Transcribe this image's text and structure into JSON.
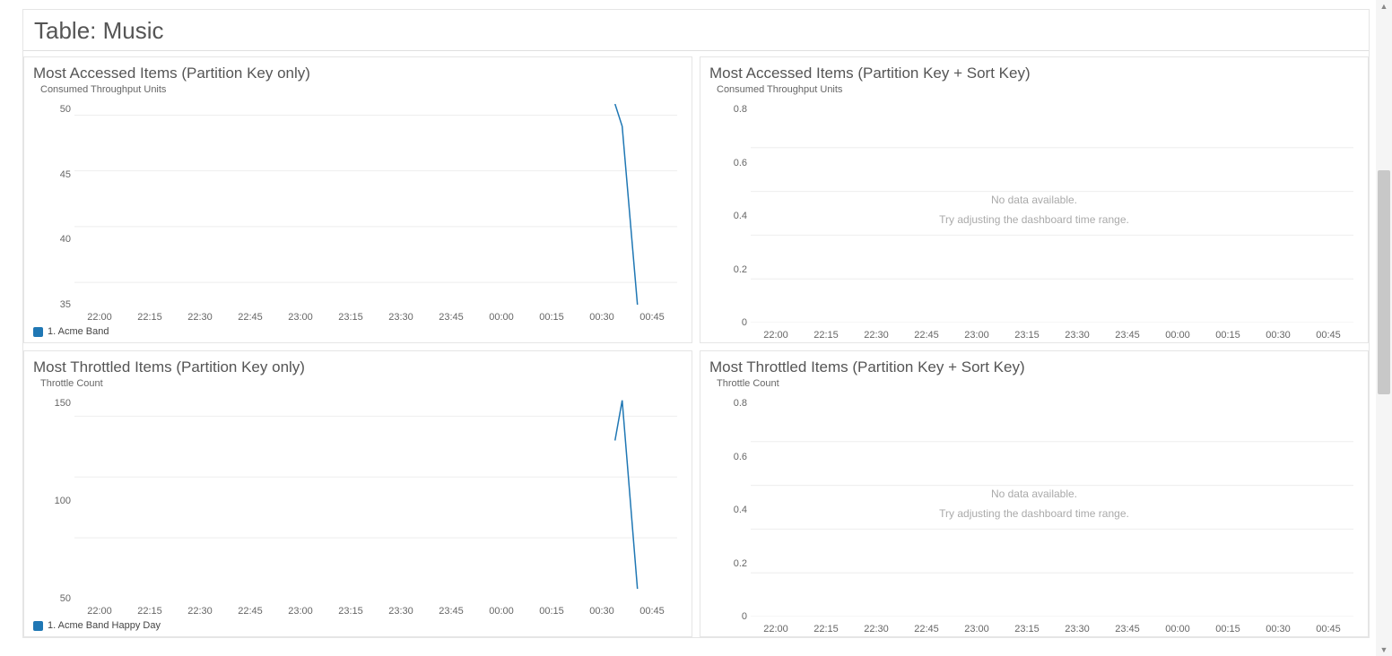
{
  "section": {
    "title": "Table: Music"
  },
  "time_labels": [
    "22:00",
    "22:15",
    "22:30",
    "22:45",
    "23:00",
    "23:15",
    "23:30",
    "23:45",
    "00:00",
    "00:15",
    "00:30",
    "00:45"
  ],
  "nodata": {
    "line1": "No data available.",
    "line2": "Try adjusting the dashboard time range."
  },
  "panels": {
    "p0": {
      "title": "Most Accessed Items (Partition Key only)",
      "yaxis_title": "Consumed Throughput Units",
      "legend": "1. Acme Band"
    },
    "p1": {
      "title": "Most Accessed Items (Partition Key + Sort Key)",
      "yaxis_title": "Consumed Throughput Units"
    },
    "p2": {
      "title": "Most Throttled Items (Partition Key only)",
      "yaxis_title": "Throttle Count",
      "legend": "1. Acme Band Happy Day"
    },
    "p3": {
      "title": "Most Throttled Items (Partition Key + Sort Key)",
      "yaxis_title": "Throttle Count"
    }
  },
  "chart_data": [
    {
      "id": "p0",
      "type": "line",
      "title": "Most Accessed Items (Partition Key only)",
      "ylabel": "Consumed Throughput Units",
      "xlabel": "",
      "x": [
        "22:00",
        "22:15",
        "22:30",
        "22:45",
        "23:00",
        "23:15",
        "23:30",
        "23:45",
        "00:00",
        "00:15",
        "00:30",
        "00:45"
      ],
      "yticks": [
        35,
        40,
        45,
        50
      ],
      "ylim": [
        33,
        51
      ],
      "series": [
        {
          "name": "1. Acme Band",
          "points": [
            {
              "x": "00:45",
              "y": 51
            },
            {
              "x": "00:47",
              "y": 49
            },
            {
              "x": "00:52",
              "y": 33
            }
          ]
        }
      ]
    },
    {
      "id": "p1",
      "type": "line",
      "title": "Most Accessed Items (Partition Key + Sort Key)",
      "ylabel": "Consumed Throughput Units",
      "xlabel": "",
      "x": [
        "22:00",
        "22:15",
        "22:30",
        "22:45",
        "23:00",
        "23:15",
        "23:30",
        "23:45",
        "00:00",
        "00:15",
        "00:30",
        "00:45"
      ],
      "yticks": [
        0,
        0.2,
        0.4,
        0.6,
        0.8
      ],
      "ylim": [
        0,
        1
      ],
      "series": [],
      "nodata": true
    },
    {
      "id": "p2",
      "type": "line",
      "title": "Most Throttled Items (Partition Key only)",
      "ylabel": "Throttle Count",
      "xlabel": "",
      "x": [
        "22:00",
        "22:15",
        "22:30",
        "22:45",
        "23:00",
        "23:15",
        "23:30",
        "23:45",
        "00:00",
        "00:15",
        "00:30",
        "00:45"
      ],
      "yticks": [
        50,
        100,
        150
      ],
      "ylim": [
        0,
        165
      ],
      "series": [
        {
          "name": "1. Acme Band Happy Day",
          "points": [
            {
              "x": "00:45",
              "y": 130
            },
            {
              "x": "00:47",
              "y": 163
            },
            {
              "x": "00:52",
              "y": 8
            }
          ]
        }
      ]
    },
    {
      "id": "p3",
      "type": "line",
      "title": "Most Throttled Items (Partition Key + Sort Key)",
      "ylabel": "Throttle Count",
      "xlabel": "",
      "x": [
        "22:00",
        "22:15",
        "22:30",
        "22:45",
        "23:00",
        "23:15",
        "23:30",
        "23:45",
        "00:00",
        "00:15",
        "00:30",
        "00:45"
      ],
      "yticks": [
        0,
        0.2,
        0.4,
        0.6,
        0.8
      ],
      "ylim": [
        0,
        1
      ],
      "series": [],
      "nodata": true
    }
  ]
}
